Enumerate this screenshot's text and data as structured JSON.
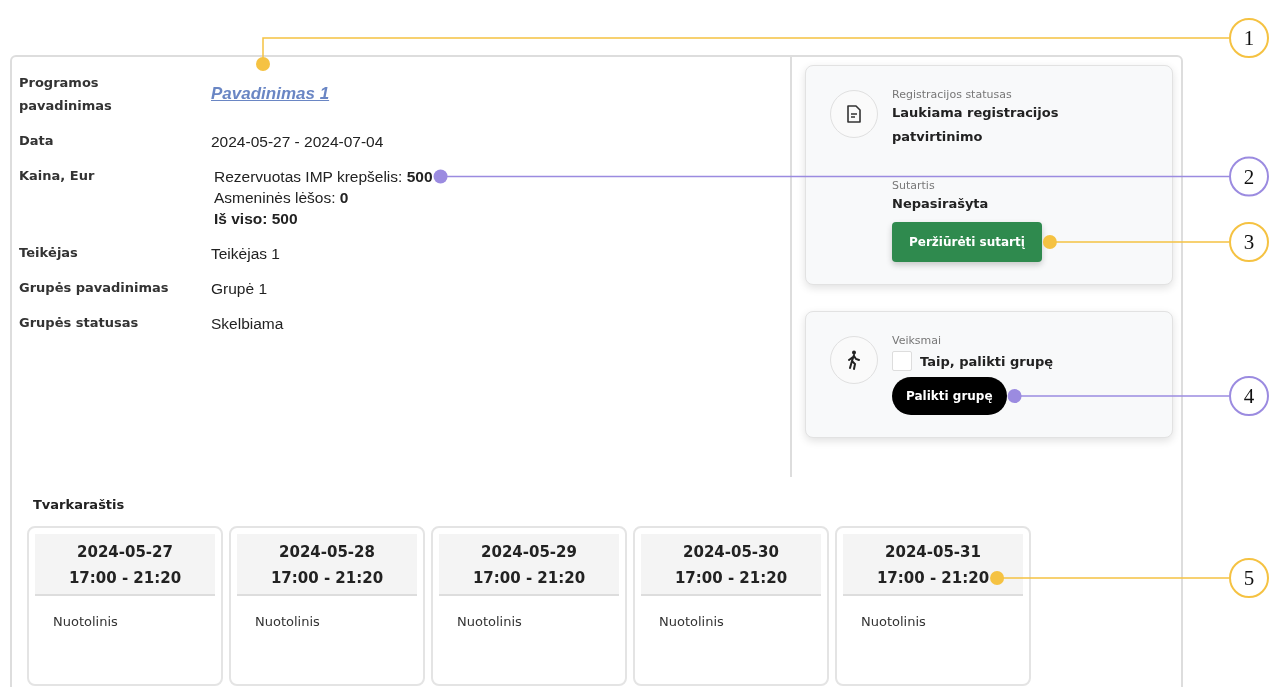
{
  "details": [
    {
      "label": "Programos pavadinimas",
      "kind": "link",
      "value": "Pavadinimas 1"
    },
    {
      "label": "Data",
      "kind": "text",
      "value": "2024-05-27 - 2024-07-04"
    },
    {
      "label": "Kaina, Eur",
      "kind": "lines",
      "lines": [
        "Rezervuotas IMP krepšelis: **500**",
        "Asmeninės lėšos: **0**",
        "**Iš viso: 500**"
      ]
    },
    {
      "label": "Teikėjas",
      "kind": "text",
      "value": "Teikėjas 1"
    },
    {
      "label": "Grupės pavadinimas",
      "kind": "text",
      "value": "Grupė 1"
    },
    {
      "label": "Grupės statusas",
      "kind": "text",
      "value": "Skelbiama"
    }
  ],
  "registration_card": {
    "status_label": "Registracijos statusas",
    "status": "Laukiama registracijos patvirtinimo",
    "contract_label": "Sutartis",
    "contract": "Nepasirašyta",
    "button": "Peržiūrėti sutartį"
  },
  "actions_card": {
    "label": "Veiksmai",
    "checkbox": {
      "label": "Taip, palikti grupę",
      "checked": false
    },
    "button": "Palikti grupę"
  },
  "schedule": {
    "title": "Tvarkaraštis",
    "sessions": [
      {
        "date": "2024-05-27",
        "time": "17:00 - 21:20",
        "mode": "Nuotolinis"
      },
      {
        "date": "2024-05-28",
        "time": "17:00 - 21:20",
        "mode": "Nuotolinis"
      },
      {
        "date": "2024-05-29",
        "time": "17:00 - 21:20",
        "mode": "Nuotolinis"
      },
      {
        "date": "2024-05-30",
        "time": "17:00 - 21:20",
        "mode": "Nuotolinis"
      },
      {
        "date": "2024-05-31",
        "time": "17:00 - 21:20",
        "mode": "Nuotolinis"
      }
    ]
  },
  "callouts": [
    {
      "number": "1",
      "color": "#f5c242"
    },
    {
      "number": "2",
      "color": "#9b8be0"
    },
    {
      "number": "3",
      "color": "#f5c242"
    },
    {
      "number": "4",
      "color": "#9b8be0"
    },
    {
      "number": "5",
      "color": "#f5c242"
    }
  ]
}
